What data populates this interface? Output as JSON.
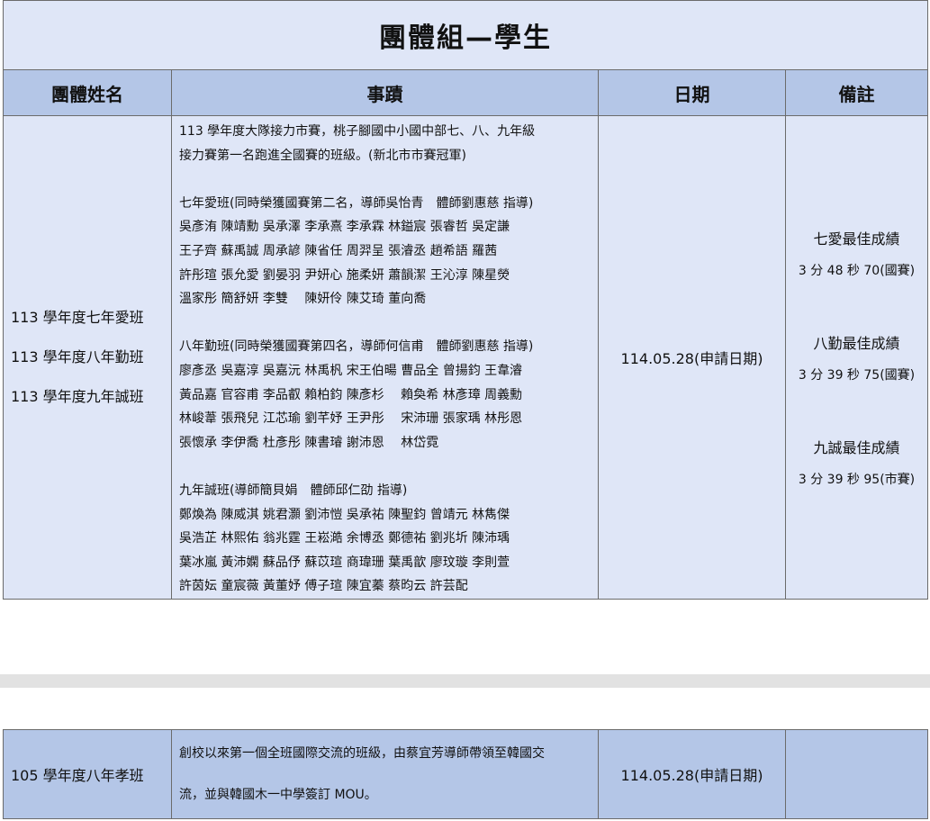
{
  "table1": {
    "title": "團體組—學生",
    "headers": [
      "團體姓名",
      "事蹟",
      "日期",
      "備註"
    ],
    "names": [
      "113 學年度七年愛班",
      "113 學年度八年勤班",
      "113 學年度九年誠班"
    ],
    "desc_blocks": [
      [
        "113 學年度大隊接力市賽，桃子腳國中小國中部七、八、九年級",
        "接力賽第一名跑進全國賽的班級。(新北市市賽冠軍)"
      ],
      [
        "七年愛班(同時榮獲國賽第二名，導師吳怡青　體師劉惠慈 指導)",
        "吳彥洧 陳靖勳 吳承澤 李承熹 李承霖 林鎰宸 張睿哲 吳定謙",
        "王子齊 蘇禹誠 周承諺 陳省任 周羿呈 張濬丞 趙希語 羅茜",
        "許彤瑄 張允愛 劉晏羽 尹妍心 施柔妍 蕭韻潔 王沁淳 陳星熒",
        "溫家彤 簡舒妍 李雙　 陳妍伶 陳艾琦 董向喬"
      ],
      [
        "八年勤班(同時榮獲國賽第四名，導師何信甫　體師劉惠慈 指導)",
        "廖彥丞 吳嘉淳 吳嘉沅 林禹杋 宋王伯暘 曹品全 曾揚鈞 王韋濬",
        "黃品嘉 官容甫 李品叡 賴柏鈞 陳彥杉　 賴奐希 林彥璋 周義勳",
        "林峻葦 張飛兒 江芯瑜 劉芊妤 王尹彤　 宋沛珊 張家瑀 林彤恩",
        "張懷承 李伊喬 杜彥彤 陳書璿 謝沛恩　 林岱霓"
      ],
      [
        "九年誠班(導師簡貝娟　體師邱仁劭 指導)",
        "鄭煥為 陳威淇 姚君灝 劉沛愷 吳承祐 陳聖鈞 曾靖元 林雋傑",
        "吳浩芷 林熙佑 翁兆霆 王崧澔 余博丞 鄭德祐 劉兆圻 陳沛瑀",
        "葉冰嵐 黃沛嫻 蘇品伃 蘇苡瑄 商瑋珊 葉禹歆 廖玟璇 李則萱",
        "許茵妘 童宸薇 黃董妤 傅子瑄 陳宜蓁 蔡昀云 許芸配"
      ]
    ],
    "date": "114.05.28(申請日期)",
    "notes": [
      {
        "title": "七愛最佳成績",
        "stat": "3 分 48 秒 70(國賽)"
      },
      {
        "title": "八勤最佳成績",
        "stat": "3 分 39 秒 75(國賽)"
      },
      {
        "title": "九誠最佳成績",
        "stat": "3 分 39 秒 95(市賽)"
      }
    ]
  },
  "table2": {
    "name": "105 學年度八年孝班",
    "desc": [
      "創校以來第一個全班國際交流的班級，由蔡宜芳導師帶領至韓國交",
      "流，並與韓國木一中學簽訂 MOU。"
    ],
    "date": "114.05.28(申請日期)",
    "note": ""
  }
}
